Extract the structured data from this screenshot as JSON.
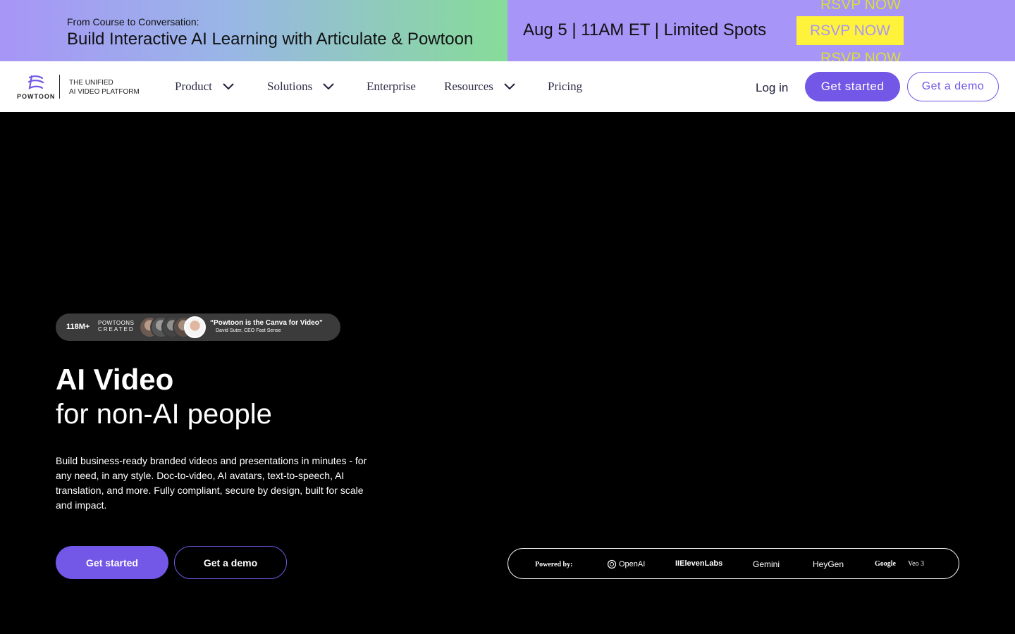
{
  "banner": {
    "kicker": "From Course to Conversation:",
    "title": "Build Interactive AI Learning with Articulate & Powtoon",
    "date": "Aug 5 | 11AM ET | Limited Spots",
    "rsvp": "RSVP NOW",
    "colors": {
      "ticket_bg": "#a795f7",
      "rsvp_bg": "#fff23a"
    }
  },
  "nav": {
    "logo_word": "POWTOON",
    "tagline_line1": "THE UNIFIED",
    "tagline_line2": "AI VIDEO PLATFORM",
    "items": [
      {
        "label": "Product",
        "has_dropdown": true
      },
      {
        "label": "Solutions",
        "has_dropdown": true
      },
      {
        "label": "Enterprise",
        "has_dropdown": false
      },
      {
        "label": "Resources",
        "has_dropdown": true
      },
      {
        "label": "Pricing",
        "has_dropdown": false
      }
    ],
    "login": "Log in",
    "get_started": "Get started",
    "get_demo": "Get a demo",
    "accent": "#7357e6"
  },
  "hero": {
    "proof": {
      "count": "118M+",
      "label_line1": "POWTOONS",
      "label_line2": "CREATED",
      "quote": "“Powtoon is the Canva for Video”",
      "attribution": "David Suter, CEO Fast Sense"
    },
    "title_line1": "AI Video",
    "title_line2": "for non-AI people",
    "description": "Build business-ready branded videos and presentations in minutes - for any need, in any style. Doc-to-video, AI avatars, text-to-speech, AI translation, and more. Fully compliant, secure by design, built for scale and impact.",
    "get_started": "Get started",
    "get_demo": "Get a demo"
  },
  "powered": {
    "label": "Powered by:",
    "partners": [
      "OpenAI",
      "IIElevenLabs",
      "Gemini",
      "HeyGen",
      "Google",
      "Veo 3"
    ]
  }
}
